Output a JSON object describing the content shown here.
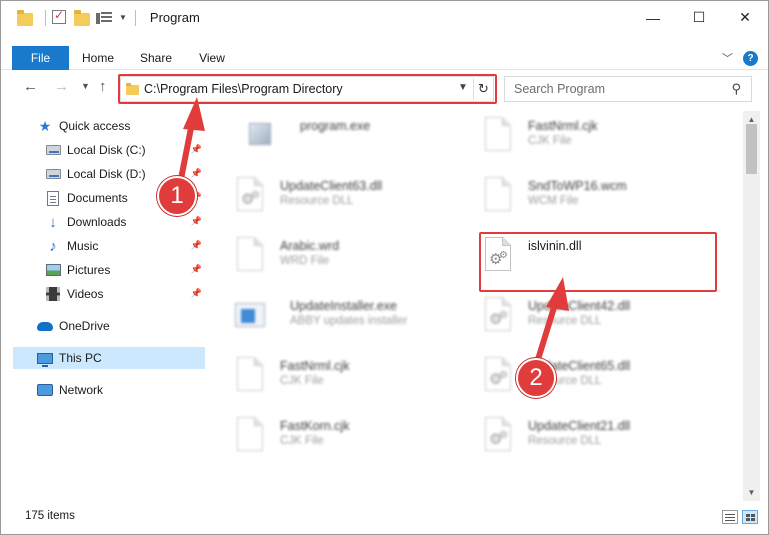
{
  "window": {
    "title": "Program",
    "controls": {
      "minimize": "—",
      "maximize": "☐",
      "close": "✕"
    }
  },
  "ribbon": {
    "tabs": [
      "File",
      "Home",
      "Share",
      "View"
    ]
  },
  "nav": {
    "address": "C:\\Program Files\\Program Directory",
    "search_placeholder": "Search Program"
  },
  "sidebar": {
    "quick_access": "Quick access",
    "pinned": [
      {
        "label": "Local Disk (C:)",
        "icon": "disk-icon"
      },
      {
        "label": "Local Disk (D:)",
        "icon": "disk-icon"
      },
      {
        "label": "Documents",
        "icon": "documents-icon"
      },
      {
        "label": "Downloads",
        "icon": "downloads-icon"
      },
      {
        "label": "Music",
        "icon": "music-icon"
      },
      {
        "label": "Pictures",
        "icon": "pictures-icon"
      },
      {
        "label": "Videos",
        "icon": "videos-icon"
      }
    ],
    "onedrive": "OneDrive",
    "this_pc": "This PC",
    "network": "Network"
  },
  "files": {
    "left": [
      {
        "name": "program.exe",
        "type": "",
        "icon": "program-icon"
      },
      {
        "name": "UpdateClient63.dll",
        "type": "Resource DLL",
        "icon": "dll-icon"
      },
      {
        "name": "Arabic.wrd",
        "type": "WRD File",
        "icon": "file-icon"
      },
      {
        "name": "UpdateInstaller.exe",
        "type": "ABBY updates installer",
        "icon": "exe-icon"
      },
      {
        "name": "FastNrml.cjk",
        "type": "CJK File",
        "icon": "file-icon"
      },
      {
        "name": "FastKorn.cjk",
        "type": "CJK File",
        "icon": "file-icon"
      }
    ],
    "right": [
      {
        "name": "FastNrml.cjk",
        "type": "CJK File",
        "icon": "file-icon"
      },
      {
        "name": "SndToWP16.wcm",
        "type": "WCM File",
        "icon": "file-icon"
      },
      {
        "name": "islvinin.dll",
        "type": "",
        "icon": "dll-icon"
      },
      {
        "name": "UpdateClient42.dll",
        "type": "Resource DLL",
        "icon": "dll-icon"
      },
      {
        "name": "UpdateClient65.dll",
        "type": "Resource DLL",
        "icon": "dll-icon"
      },
      {
        "name": "UpdateClient21.dll",
        "type": "Resource DLL",
        "icon": "dll-icon"
      }
    ]
  },
  "status": {
    "items": "175 items"
  },
  "annotations": {
    "step1": "1",
    "step2": "2",
    "color": "#e03c3c"
  }
}
